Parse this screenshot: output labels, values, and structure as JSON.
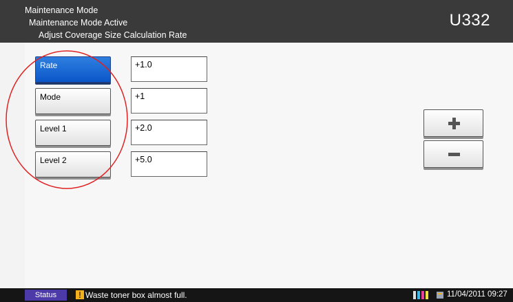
{
  "header": {
    "line1": "Maintenance Mode",
    "line2": "Maintenance Mode Active",
    "line3": "Adjust Coverage Size Calculation Rate",
    "code": "U332"
  },
  "items": [
    {
      "label": "Rate",
      "value": "+1.0",
      "selected": true
    },
    {
      "label": "Mode",
      "value": "+1",
      "selected": false
    },
    {
      "label": "Level 1",
      "value": "+2.0",
      "selected": false
    },
    {
      "label": "Level 2",
      "value": "+5.0",
      "selected": false
    }
  ],
  "adjust": {
    "plus_icon": "plus-icon",
    "minus_icon": "minus-icon"
  },
  "status_bar": {
    "status_label": "Status",
    "message": "Waste toner box almost full.",
    "datetime": "11/04/2011 09:27",
    "warning_icon": "warning-icon",
    "toner_icon": "toner-icon",
    "job_icon": "job-icon"
  },
  "colors": {
    "header_bg": "#3a3a3a",
    "selected_button": "#0b56c9",
    "status_button": "#4b3aa8",
    "annotation_circle": "#e02020"
  }
}
